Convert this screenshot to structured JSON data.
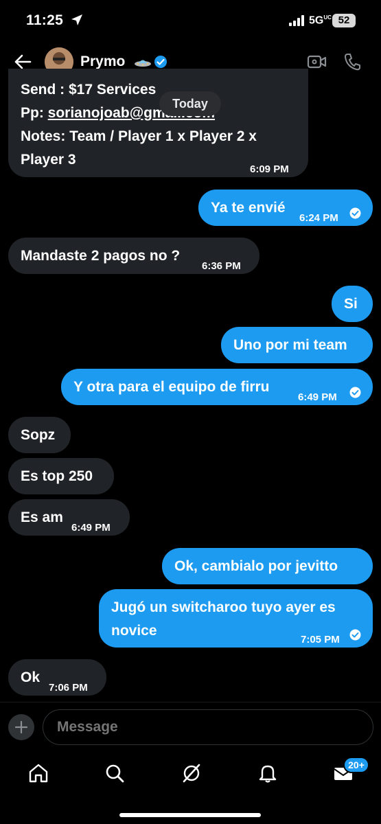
{
  "status_bar": {
    "time": "11:25",
    "network": "5G",
    "network_sup": "UC",
    "battery": "52"
  },
  "header": {
    "contact_name": "Prymo"
  },
  "date_divider": "Today",
  "messages": [
    {
      "dir": "in",
      "lines": [
        "Send : $17 Services",
        "Pp: ",
        "sorianojoab@gmail.com",
        "Notes: Team / Player 1 x Player 2 x",
        "Player 3"
      ],
      "time": "6:09 PM"
    },
    {
      "dir": "out",
      "text": "Ya te envié",
      "time": "6:24 PM"
    },
    {
      "dir": "in",
      "text": "Mandaste 2 pagos no ?",
      "time": "6:36 PM"
    },
    {
      "dir": "out",
      "text": "Si"
    },
    {
      "dir": "out",
      "text": "Uno por mi team"
    },
    {
      "dir": "out",
      "text": "Y otra para el equipo de firru",
      "time": "6:49 PM"
    },
    {
      "dir": "in",
      "text": "Sopz"
    },
    {
      "dir": "in",
      "text": "Es top 250"
    },
    {
      "dir": "in",
      "text": "Es am",
      "time": "6:49 PM"
    },
    {
      "dir": "out",
      "text": "Ok, cambialo por jevitto"
    },
    {
      "dir": "out",
      "lines": [
        "Jugó un switcharoo tuyo ayer es",
        "novice"
      ],
      "time": "7:05 PM"
    },
    {
      "dir": "in",
      "text": "Ok",
      "time": "7:06 PM"
    }
  ],
  "composer": {
    "placeholder": "Message"
  },
  "tab_bar": {
    "items": [
      "home-icon",
      "search-icon",
      "grok-icon",
      "notifications-icon",
      "messages-icon"
    ],
    "messages_badge": "20+"
  },
  "colors": {
    "outgoing": "#1d9bf0",
    "incoming": "#202327",
    "background": "#000000"
  }
}
